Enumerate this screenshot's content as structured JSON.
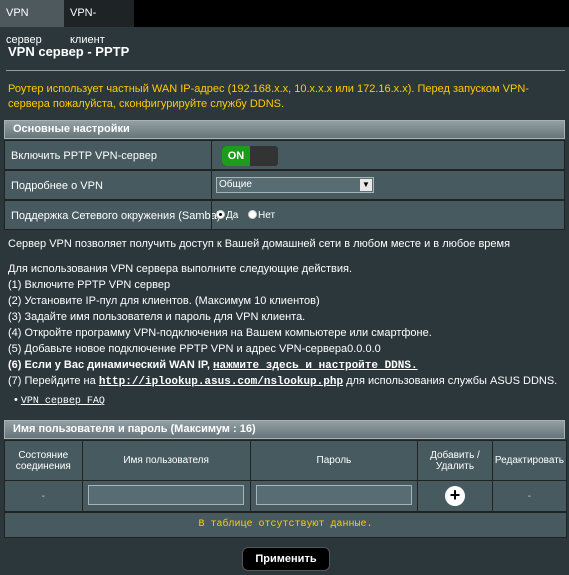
{
  "tabs": [
    "VPN сервер",
    "VPN-клиент"
  ],
  "page_title": "VPN сервер - PPTP",
  "notice": "Роутер использует частный WAN IP-адрес (192.168.x.x, 10.x.x.x или 172.16.x.x). Перед запуском VPN-сервера пожалуйста, сконфигурируйте службу DDNS.",
  "basic": {
    "header": "Основные настройки",
    "enable_label": "Включить PPTP VPN-сервер",
    "enable_state": "ON",
    "details_label": "Подробнее о VPN",
    "details_value": "Общие",
    "samba_label": "Поддержка Сетевого окружения (Samba)",
    "samba_yes": "Да",
    "samba_no": "Нет"
  },
  "info": {
    "intro": "Сервер VPN позволяет получить доступ к Вашей домашней сети в любом месте и в любое время",
    "steps_title": "Для использования VPN сервера выполните следующие действия.",
    "step1": "(1) Включите PPTP VPN сервер",
    "step2": "(2) Установите IP-пул для клиентов. (Максимум 10 клиентов)",
    "step3": "(3) Задайте имя пользователя и пароль для VPN клиента.",
    "step4": "(4) Откройте программу VPN-подключения на Вашем компьютере или смартфоне.",
    "step5": "(5) Добавьте новое подключение PPTP VPN и адрес VPN-сервера0.0.0.0",
    "step6_prefix": "(6) Если у Вас динамический WAN IP, ",
    "step6_link": "нажмите здесь и настройте DDNS.",
    "step7_prefix": "(7) Перейдите на ",
    "step7_link": "http://iplookup.asus.com/nslookup.php",
    "step7_suffix": " для использования службы ASUS DDNS.",
    "faq": "VPN сервер FAQ"
  },
  "users": {
    "header": "Имя пользователя и пароль (Максимум : 16)",
    "col_status": "Состояние соединения",
    "col_username": "Имя пользователя",
    "col_password": "Пароль",
    "col_add": "Добавить / Удалить",
    "col_edit": "Редактировать",
    "row_status": "-",
    "row_edit": "-",
    "empty": "В таблице отсутствуют данные."
  },
  "apply_label": "Применить"
}
